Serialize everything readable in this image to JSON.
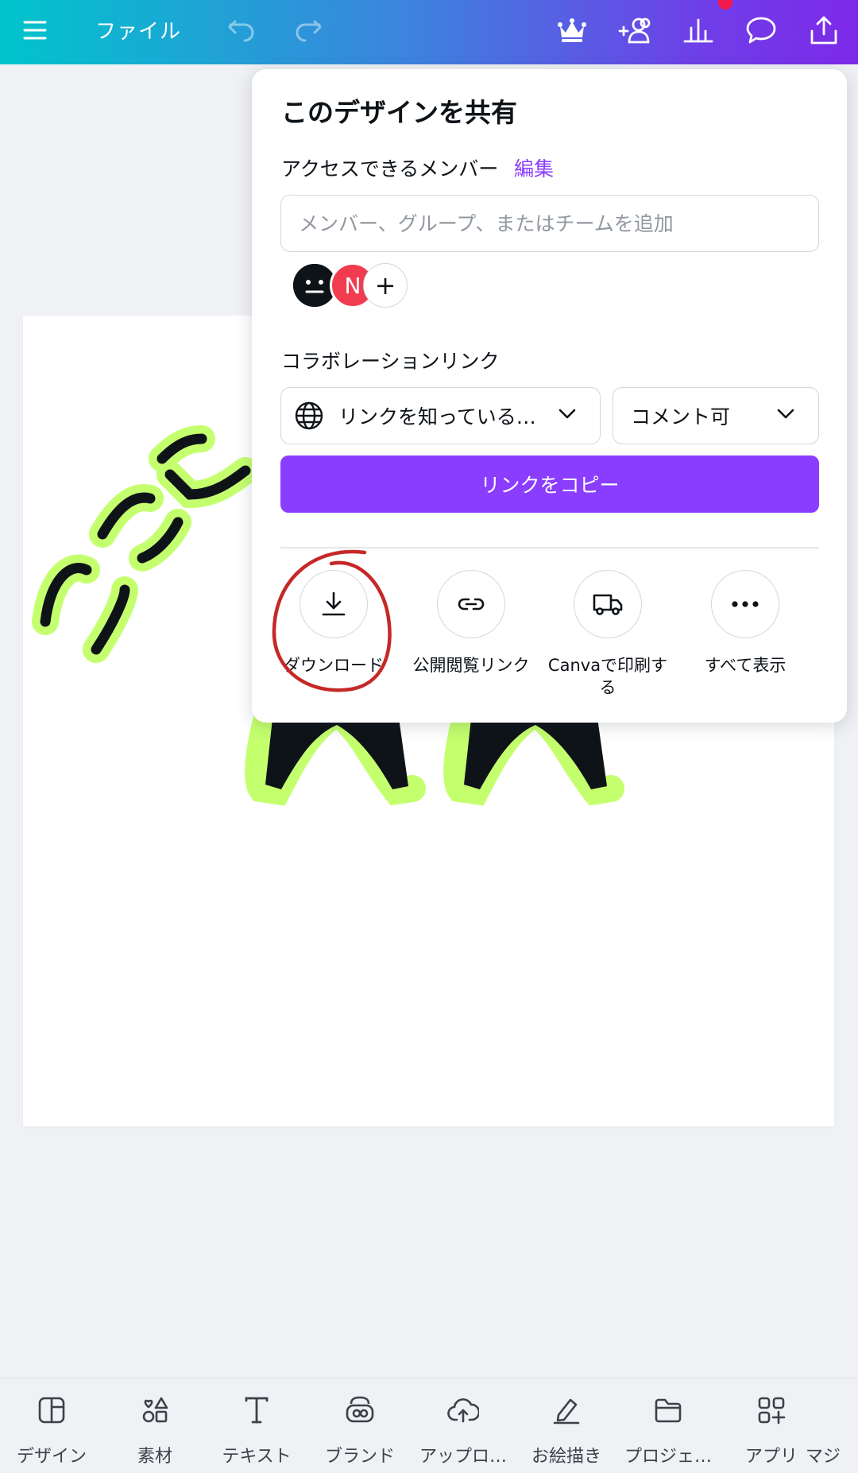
{
  "topbar": {
    "file_label": "ファイル",
    "icons": [
      "menu-icon",
      "undo-icon",
      "redo-icon",
      "crown-icon",
      "add-people-icon",
      "analytics-icon",
      "comment-icon",
      "share-upload-icon"
    ]
  },
  "share_panel": {
    "title": "このデザインを共有",
    "access_label": "アクセスできるメンバー",
    "edit_label": "編集",
    "member_input_placeholder": "メンバー、グループ、またはチームを追加",
    "avatar_initial": "N",
    "add_glyph": "+",
    "collab_label": "コラボレーションリンク",
    "link_access_value": "リンクを知っている…",
    "permission_value": "コメント可",
    "copy_link_button": "リンクをコピー",
    "actions": [
      {
        "label": "ダウンロード",
        "icon": "download-icon"
      },
      {
        "label": "公開閲覧リンク",
        "icon": "link-icon"
      },
      {
        "label": "Canvaで印刷する",
        "icon": "truck-icon"
      },
      {
        "label": "すべて表示",
        "icon": "more-icon"
      }
    ]
  },
  "bottom_nav": [
    {
      "label": "デザイン",
      "icon": "design-icon"
    },
    {
      "label": "素材",
      "icon": "elements-icon"
    },
    {
      "label": "テキスト",
      "icon": "text-icon"
    },
    {
      "label": "ブランド",
      "icon": "brand-icon"
    },
    {
      "label": "アップロ…",
      "icon": "upload-icon"
    },
    {
      "label": "お絵描き",
      "icon": "draw-icon"
    },
    {
      "label": "プロジェ…",
      "icon": "folder-icon"
    },
    {
      "label": "アプリ",
      "icon": "apps-icon"
    },
    {
      "label": "マジ",
      "icon": "magic-icon"
    }
  ],
  "colors": {
    "accent": "#8b3dff",
    "gradient_start": "#00c4cc",
    "gradient_end": "#7d2ae8",
    "annotation": "#c62828",
    "stroke_glow": "#c4ff6e",
    "notification": "#f21a4a"
  }
}
